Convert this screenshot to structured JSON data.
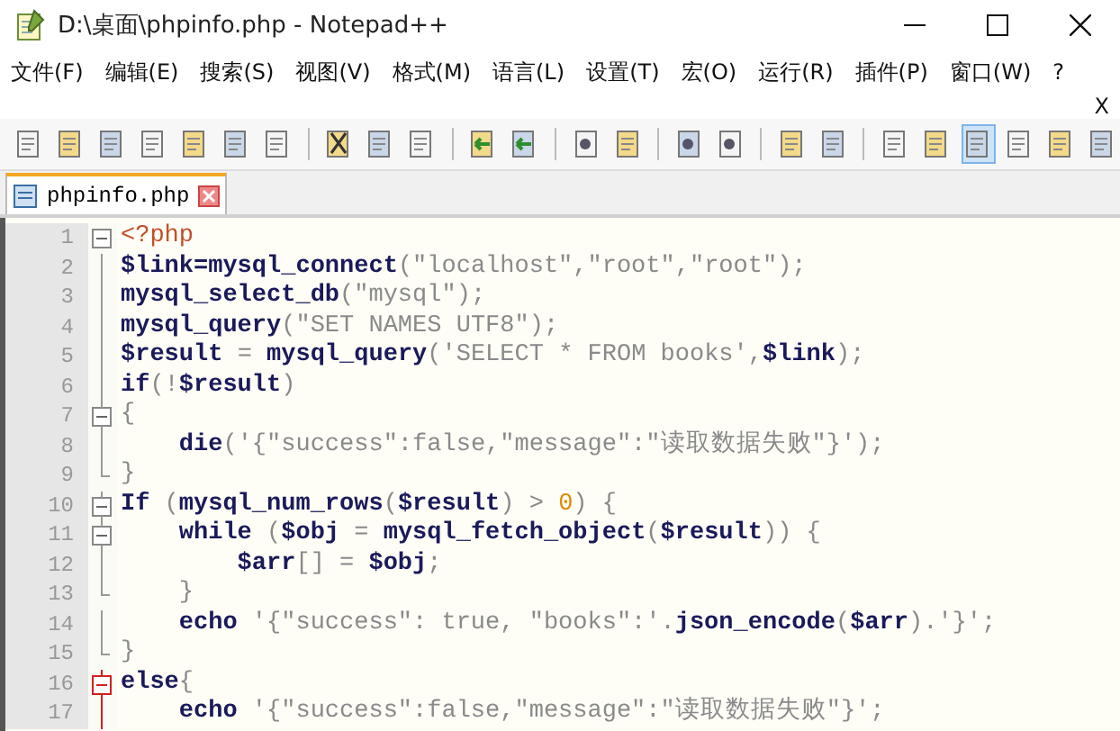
{
  "window": {
    "title": "D:\\桌面\\phpinfo.php - Notepad++"
  },
  "menu": [
    "文件(F)",
    "编辑(E)",
    "搜索(S)",
    "视图(V)",
    "格式(M)",
    "语言(L)",
    "设置(T)",
    "宏(O)",
    "运行(R)",
    "插件(P)",
    "窗口(W)",
    "?"
  ],
  "close_document": "X",
  "toolbar": [
    {
      "pressed": false
    },
    {
      "pressed": false
    },
    {
      "pressed": false
    },
    {
      "pressed": false
    },
    {
      "pressed": false
    },
    {
      "pressed": false
    },
    {
      "pressed": false
    },
    {
      "pressed": false
    },
    {
      "pressed": false
    },
    {
      "pressed": false
    },
    {
      "pressed": false
    },
    {
      "pressed": false
    },
    {
      "pressed": false
    },
    {
      "pressed": false
    },
    {
      "pressed": false
    },
    {
      "pressed": false
    },
    {
      "pressed": false
    },
    {
      "pressed": false
    },
    {
      "pressed": false
    },
    {
      "pressed": false
    },
    {
      "pressed": true
    },
    {
      "pressed": false
    },
    {
      "pressed": false
    },
    {
      "pressed": false
    }
  ],
  "tabs": [
    {
      "label": "phpinfo.php",
      "selected": true
    }
  ],
  "editor": {
    "lines": [
      {
        "number": "1",
        "kind": "open",
        "current_block": false,
        "tokens": [
          {
            "kind": "tag",
            "text": "<?php"
          }
        ]
      },
      {
        "number": "2",
        "kind": "line",
        "current_block": false,
        "tokens": [
          {
            "kind": "bold",
            "text": "$link=mysql_connect"
          },
          {
            "kind": "plain",
            "text": "(\"localhost\",\"root\",\"root\");"
          }
        ]
      },
      {
        "number": "3",
        "kind": "line",
        "current_block": false,
        "tokens": [
          {
            "kind": "bold",
            "text": "mysql_select_db"
          },
          {
            "kind": "plain",
            "text": "(\"mysql\");"
          }
        ]
      },
      {
        "number": "4",
        "kind": "line",
        "current_block": false,
        "tokens": [
          {
            "kind": "bold",
            "text": "mysql_query"
          },
          {
            "kind": "plain",
            "text": "(\"SET NAMES UTF8\");"
          }
        ]
      },
      {
        "number": "5",
        "kind": "line",
        "current_block": false,
        "tokens": [
          {
            "kind": "bold",
            "text": "$result"
          },
          {
            "kind": "plain",
            "text": " = "
          },
          {
            "kind": "bold",
            "text": "mysql_query"
          },
          {
            "kind": "plain",
            "text": "('SELECT * FROM books',"
          },
          {
            "kind": "bold",
            "text": "$link"
          },
          {
            "kind": "plain",
            "text": ");"
          }
        ]
      },
      {
        "number": "6",
        "kind": "line",
        "current_block": false,
        "tokens": [
          {
            "kind": "bold",
            "text": "if"
          },
          {
            "kind": "plain",
            "text": "(!"
          },
          {
            "kind": "bold",
            "text": "$result"
          },
          {
            "kind": "plain",
            "text": ")"
          }
        ]
      },
      {
        "number": "7",
        "kind": "open",
        "current_block": false,
        "tokens": [
          {
            "kind": "plain",
            "text": "{"
          }
        ]
      },
      {
        "number": "8",
        "kind": "line",
        "current_block": false,
        "tokens": [
          {
            "kind": "bold",
            "text": "    die"
          },
          {
            "kind": "plain",
            "text": "('{\"success\":false,\"message\":\"读取数据失败\"}');"
          }
        ]
      },
      {
        "number": "9",
        "kind": "close",
        "current_block": false,
        "tokens": [
          {
            "kind": "plain",
            "text": "}"
          }
        ]
      },
      {
        "number": "10",
        "kind": "open",
        "current_block": false,
        "tokens": [
          {
            "kind": "bold",
            "text": "If"
          },
          {
            "kind": "plain",
            "text": " ("
          },
          {
            "kind": "bold",
            "text": "mysql_num_rows"
          },
          {
            "kind": "plain",
            "text": "("
          },
          {
            "kind": "bold",
            "text": "$result"
          },
          {
            "kind": "plain",
            "text": ") > "
          },
          {
            "kind": "number",
            "text": "0"
          },
          {
            "kind": "plain",
            "text": ") {"
          }
        ]
      },
      {
        "number": "11",
        "kind": "open",
        "current_block": false,
        "tokens": [
          {
            "kind": "bold",
            "text": "    while"
          },
          {
            "kind": "plain",
            "text": " ("
          },
          {
            "kind": "bold",
            "text": "$obj"
          },
          {
            "kind": "plain",
            "text": " = "
          },
          {
            "kind": "bold",
            "text": "mysql_fetch_object"
          },
          {
            "kind": "plain",
            "text": "("
          },
          {
            "kind": "bold",
            "text": "$result"
          },
          {
            "kind": "plain",
            "text": ")) {"
          }
        ]
      },
      {
        "number": "12",
        "kind": "line",
        "current_block": false,
        "tokens": [
          {
            "kind": "bold",
            "text": "        $arr"
          },
          {
            "kind": "plain",
            "text": "[] = "
          },
          {
            "kind": "bold",
            "text": "$obj"
          },
          {
            "kind": "plain",
            "text": ";"
          }
        ]
      },
      {
        "number": "13",
        "kind": "close",
        "current_block": false,
        "tokens": [
          {
            "kind": "plain",
            "text": "    }"
          }
        ]
      },
      {
        "number": "14",
        "kind": "line",
        "current_block": false,
        "tokens": [
          {
            "kind": "bold",
            "text": "    echo"
          },
          {
            "kind": "plain",
            "text": " '{\"success\": true, \"books\":'."
          },
          {
            "kind": "bold",
            "text": "json_encode"
          },
          {
            "kind": "plain",
            "text": "("
          },
          {
            "kind": "bold",
            "text": "$arr"
          },
          {
            "kind": "plain",
            "text": ").'}';"
          }
        ]
      },
      {
        "number": "15",
        "kind": "close",
        "current_block": false,
        "tokens": [
          {
            "kind": "plain",
            "text": "}"
          }
        ]
      },
      {
        "number": "16",
        "kind": "open",
        "current_block": true,
        "tokens": [
          {
            "kind": "bold",
            "text": "else"
          },
          {
            "kind": "plain",
            "text": "{"
          }
        ]
      },
      {
        "number": "17",
        "kind": "line",
        "current_block": true,
        "tokens": [
          {
            "kind": "bold",
            "text": "    echo"
          },
          {
            "kind": "plain",
            "text": " '{\"success\":false,\"message\":\"读取数据失败\"}';"
          }
        ]
      }
    ]
  }
}
